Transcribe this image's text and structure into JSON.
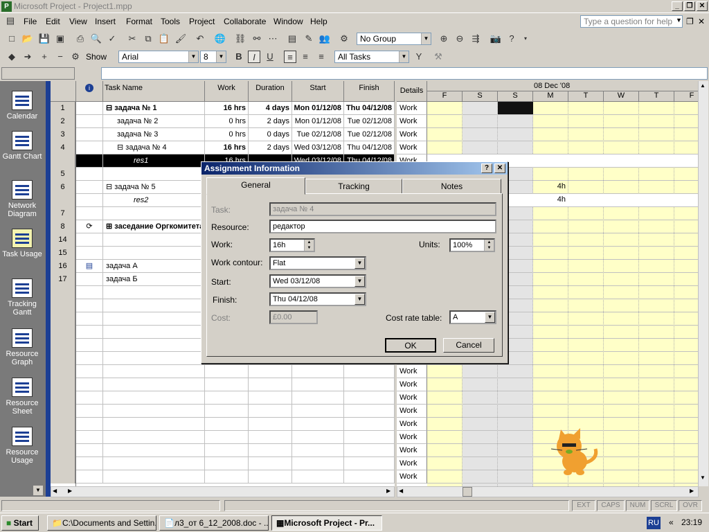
{
  "window": {
    "title": "Microsoft Project - Project1.mpp"
  },
  "menu": [
    "File",
    "Edit",
    "View",
    "Insert",
    "Format",
    "Tools",
    "Project",
    "Collaborate",
    "Window",
    "Help"
  ],
  "help_placeholder": "Type a question for help",
  "toolbar": {
    "group": "No Group",
    "show_label": "Show",
    "font": "Arial",
    "size": "8",
    "filter": "All Tasks"
  },
  "viewbar": [
    "Calendar",
    "Gantt Chart",
    "Network Diagram",
    "Task Usage",
    "Tracking Gantt",
    "Resource Graph",
    "Resource Sheet",
    "Resource Usage"
  ],
  "grid": {
    "headers": {
      "name": "Task Name",
      "work": "Work",
      "duration": "Duration",
      "start": "Start",
      "finish": "Finish"
    },
    "rows": [
      {
        "id": "1",
        "name": "задача № 1",
        "work": "16 hrs",
        "duration": "4 days",
        "start": "Mon 01/12/08",
        "finish": "Thu 04/12/08"
      },
      {
        "id": "2",
        "name": "задача № 2",
        "work": "0 hrs",
        "duration": "2 days",
        "start": "Mon 01/12/08",
        "finish": "Tue 02/12/08"
      },
      {
        "id": "3",
        "name": "задача № 3",
        "work": "0 hrs",
        "duration": "0 days",
        "start": "Tue 02/12/08",
        "finish": "Tue 02/12/08"
      },
      {
        "id": "4",
        "name": "задача № 4",
        "work": "16 hrs",
        "duration": "2 days",
        "start": "Wed 03/12/08",
        "finish": "Thu 04/12/08"
      },
      {
        "id": "",
        "name": "res1",
        "work": "16 hrs",
        "duration": "",
        "start": "Wed 03/12/08",
        "finish": "Thu 04/12/08"
      },
      {
        "id": "5",
        "name": "",
        "work": "",
        "duration": "",
        "start": "",
        "finish": ""
      },
      {
        "id": "6",
        "name": "задача № 5",
        "work": "",
        "duration": "",
        "start": "",
        "finish": ""
      },
      {
        "id": "",
        "name": "res2",
        "work": "",
        "duration": "",
        "start": "",
        "finish": ""
      },
      {
        "id": "7",
        "name": "",
        "work": "",
        "duration": "",
        "start": "",
        "finish": ""
      },
      {
        "id": "8",
        "name": "заседание Оргкомитета",
        "work": "",
        "duration": "",
        "start": "",
        "finish": ""
      },
      {
        "id": "14",
        "name": "",
        "work": "",
        "duration": "",
        "start": "",
        "finish": ""
      },
      {
        "id": "15",
        "name": "",
        "work": "",
        "duration": "",
        "start": "",
        "finish": ""
      },
      {
        "id": "16",
        "name": "задача А",
        "work": "",
        "duration": "",
        "start": "",
        "finish": ""
      },
      {
        "id": "17",
        "name": "задача Б",
        "work": "",
        "duration": "",
        "start": "",
        "finish": ""
      }
    ]
  },
  "chart": {
    "details": "Details",
    "week": "08 Dec '08",
    "days": [
      "F",
      "S",
      "S",
      "M",
      "T",
      "W",
      "T",
      "F"
    ],
    "work_label": "Work",
    "cell_4h": "4h"
  },
  "dialog": {
    "title": "Assignment Information",
    "tabs": [
      "General",
      "Tracking",
      "Notes"
    ],
    "task_label": "Task:",
    "task_value": "задача № 4",
    "resource_label": "Resource:",
    "resource_value": "редактор",
    "work_label": "Work:",
    "work_value": "16h",
    "units_label": "Units:",
    "units_value": "100%",
    "contour_label": "Work contour:",
    "contour_value": "Flat",
    "start_label": "Start:",
    "start_value": "Wed 03/12/08",
    "finish_label": "Finish:",
    "finish_value": "Thu 04/12/08",
    "cost_label": "Cost:",
    "cost_value": "£0.00",
    "costrate_label": "Cost rate table:",
    "costrate_value": "A",
    "ok": "OK",
    "cancel": "Cancel"
  },
  "status": [
    "EXT",
    "CAPS",
    "NUM",
    "SCRL",
    "OVR"
  ],
  "taskbar": {
    "start": "Start",
    "items": [
      "C:\\Documents and Settin...",
      "л3_от 6_12_2008.doc - ...",
      "Microsoft Project - Pr..."
    ],
    "lang": "RU",
    "time": "23:19"
  }
}
